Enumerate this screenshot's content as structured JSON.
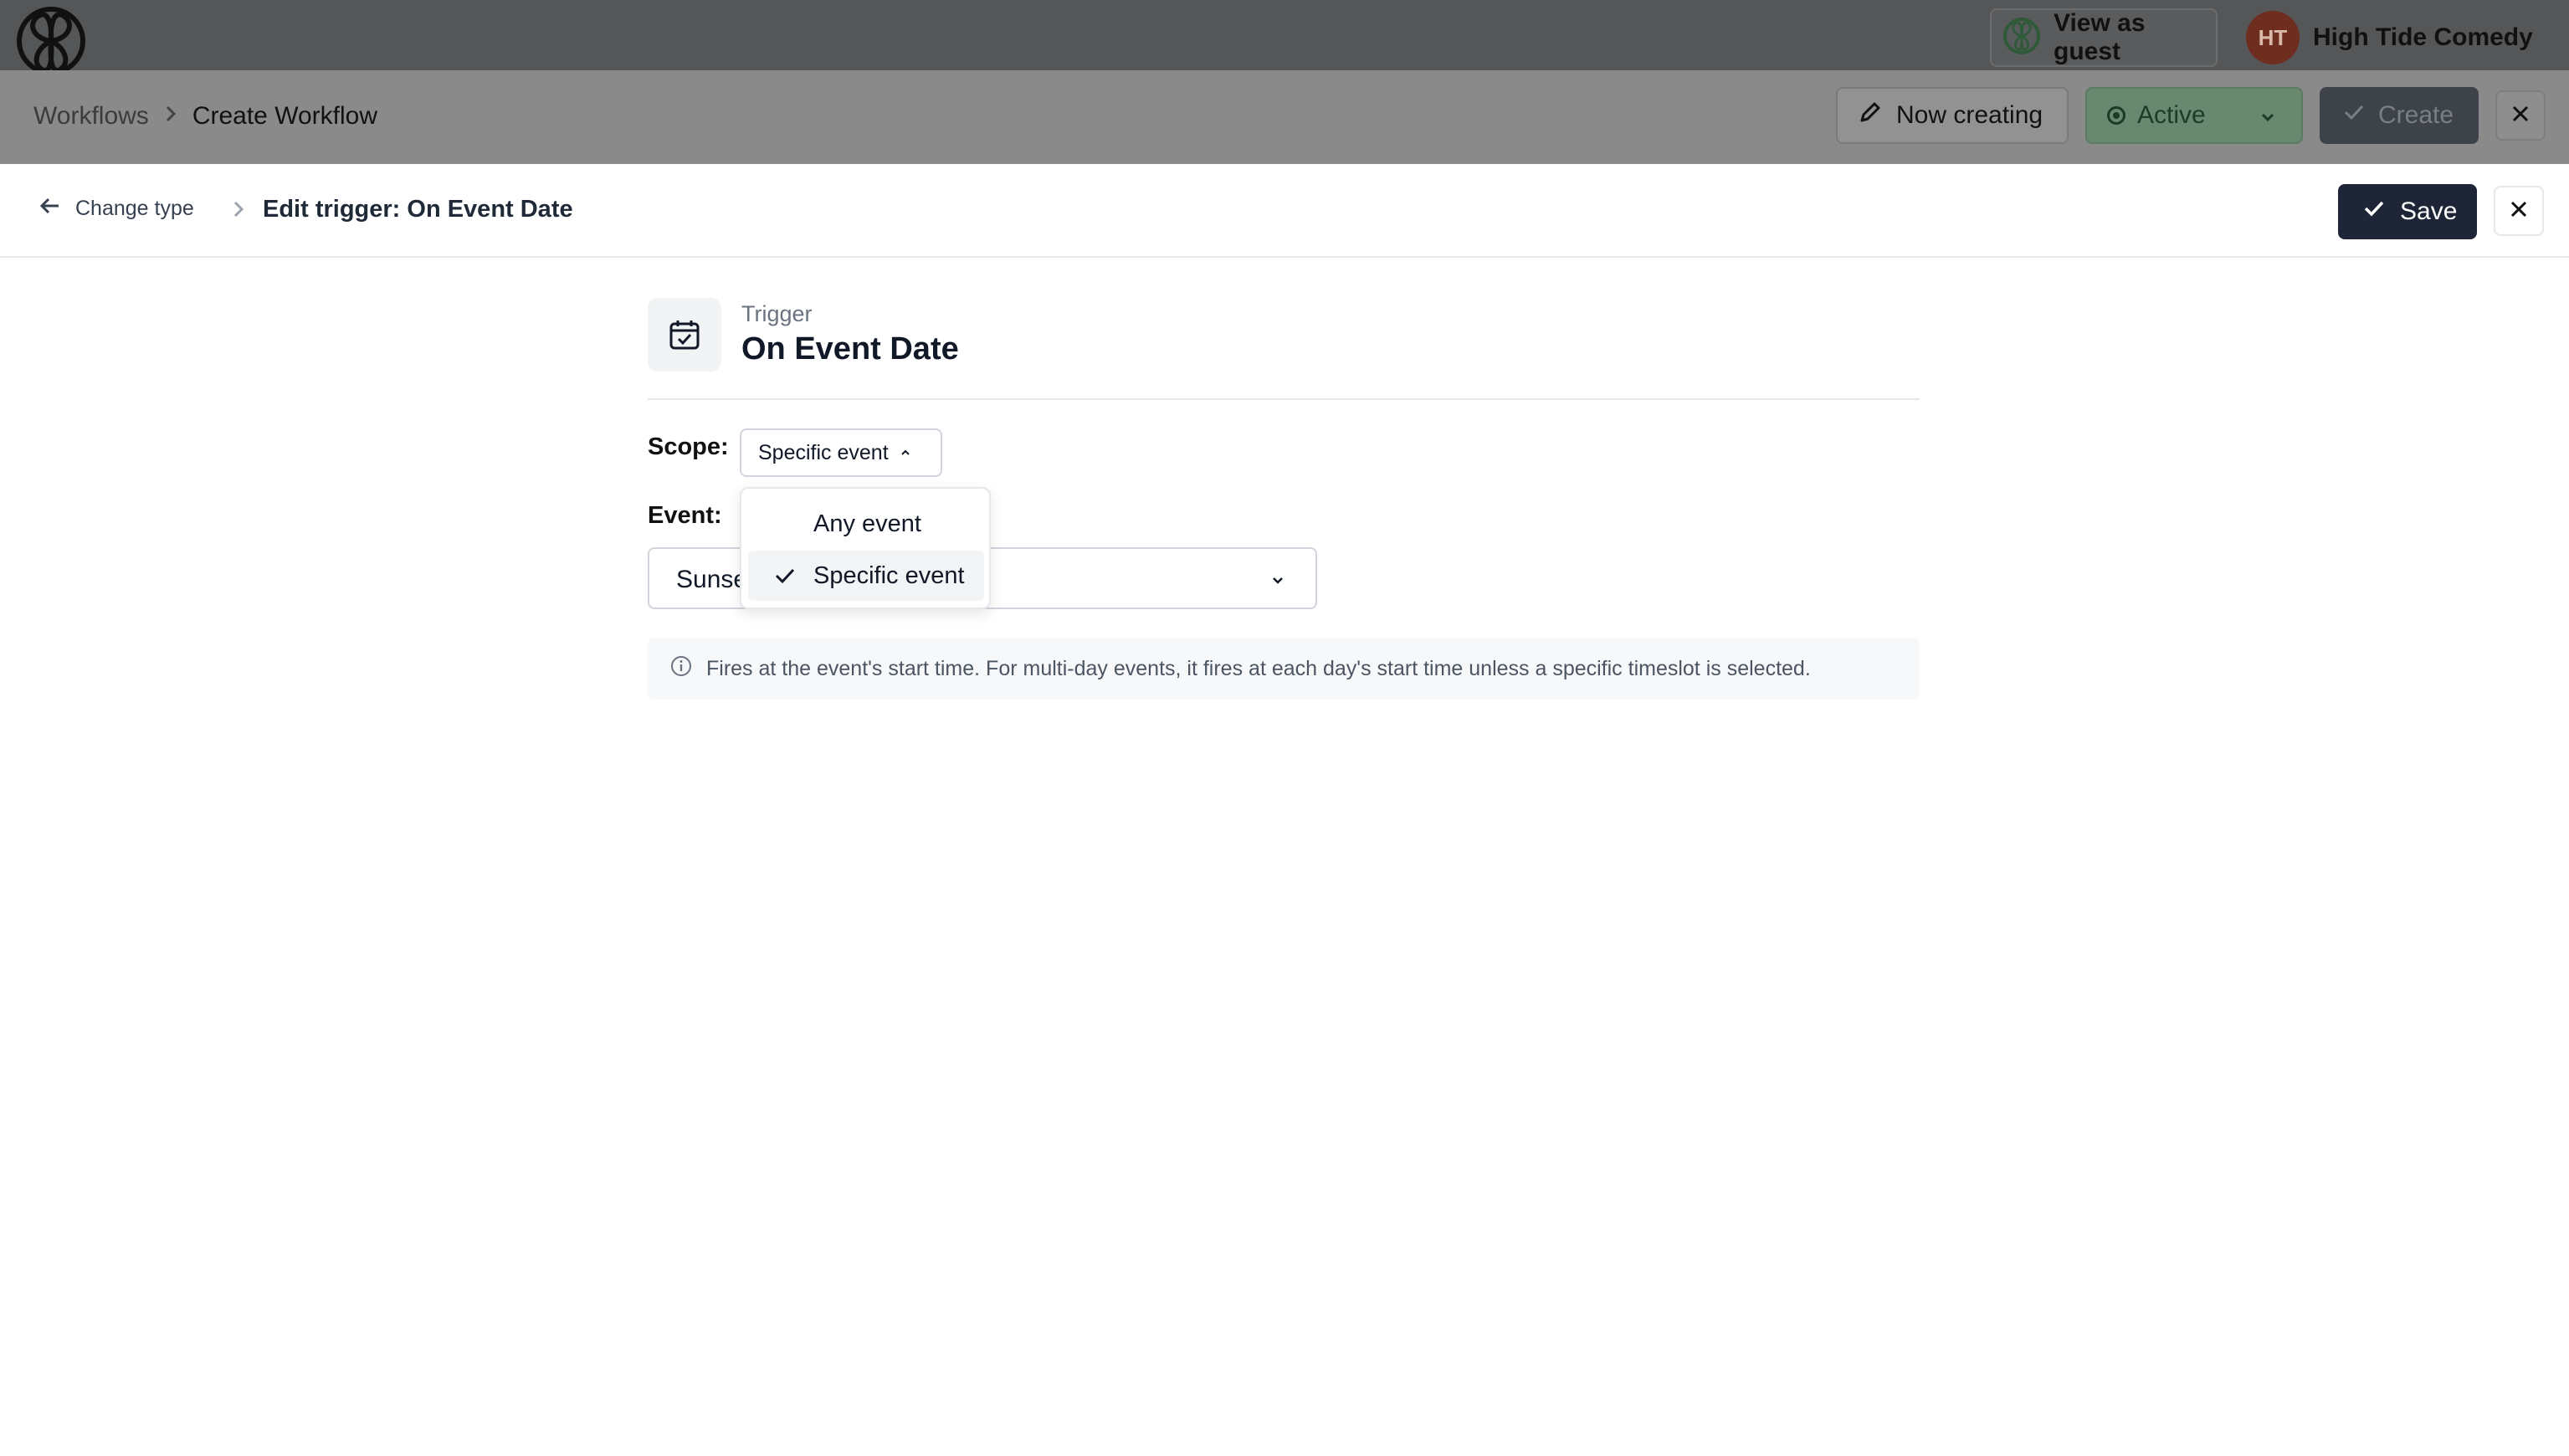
{
  "header": {
    "view_as_guest": "View as guest",
    "org_initials": "HT",
    "org_name": "High Tide Comedy"
  },
  "subheader": {
    "breadcrumb": [
      "Workflows",
      "Create Workflow"
    ],
    "now_creating": "Now creating",
    "status": "Active",
    "create": "Create"
  },
  "panel": {
    "back_label": "Change type",
    "title": "Edit trigger: On Event Date",
    "save": "Save",
    "trigger_label": "Trigger",
    "trigger_title": "On Event Date",
    "scope_label": "Scope:",
    "scope_value": "Specific event",
    "event_label": "Event:",
    "event_value": "Sunse",
    "info_text": "Fires at the event's start time. For multi-day events, it fires at each day's start time unless a specific timeslot is selected."
  },
  "scope_dropdown": {
    "options": [
      "Any event",
      "Specific event"
    ],
    "selected": "Specific event"
  },
  "colors": {
    "save_bg": "#1d2537",
    "active_bg": "#68896f",
    "overlay_top": "#555657"
  }
}
